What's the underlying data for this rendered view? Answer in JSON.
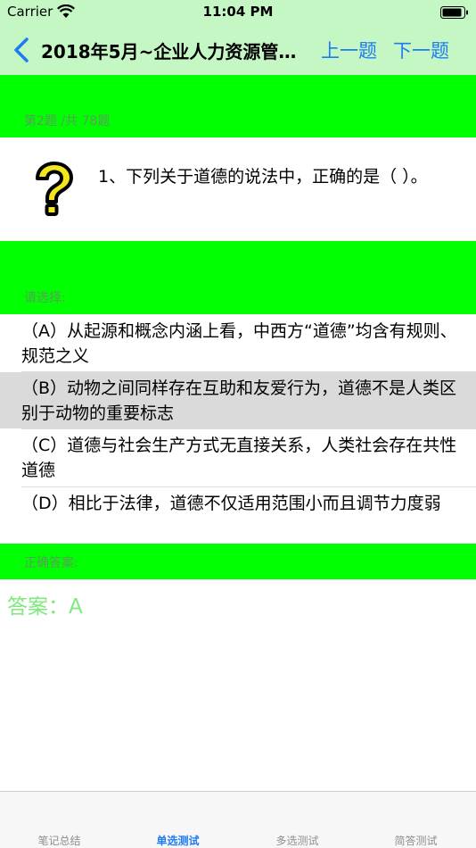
{
  "status_bar": {
    "carrier": "Carrier",
    "time": "11:04 PM"
  },
  "nav": {
    "title": "2018年5月~企业人力资源管…",
    "prev_label": "上一题",
    "next_label": "下一题"
  },
  "progress": {
    "label": "第2题 /共 78题"
  },
  "question": {
    "text": "1、下列关于道德的说法中，正确的是（   ）。"
  },
  "choose": {
    "label": "请选择:"
  },
  "options": [
    {
      "text": "（A）从起源和概念内涵上看，中西方“道德”均含有规则、规范之义"
    },
    {
      "text": "（B）动物之间同样存在互助和友爱行为，道德不是人类区别于动物的重要标志"
    },
    {
      "text": "（C）道德与社会生产方式无直接关系，人类社会存在共性道德"
    },
    {
      "text": "（D）相比于法律，道德不仅适用范围小而且调节力度弱"
    }
  ],
  "selected_option": 1,
  "correct": {
    "label": "正确答案:",
    "answer": "答案：A"
  },
  "tabs": [
    {
      "label": "笔记总结"
    },
    {
      "label": "单选测试"
    },
    {
      "label": "多选测试"
    },
    {
      "label": "简答测试"
    }
  ],
  "active_tab": 1,
  "colors": {
    "header_bg": "#c5f7c5",
    "band": "#00ff00",
    "accent": "#1e7cf2",
    "answer": "#7ceb7c",
    "selected_row": "#dadada"
  }
}
